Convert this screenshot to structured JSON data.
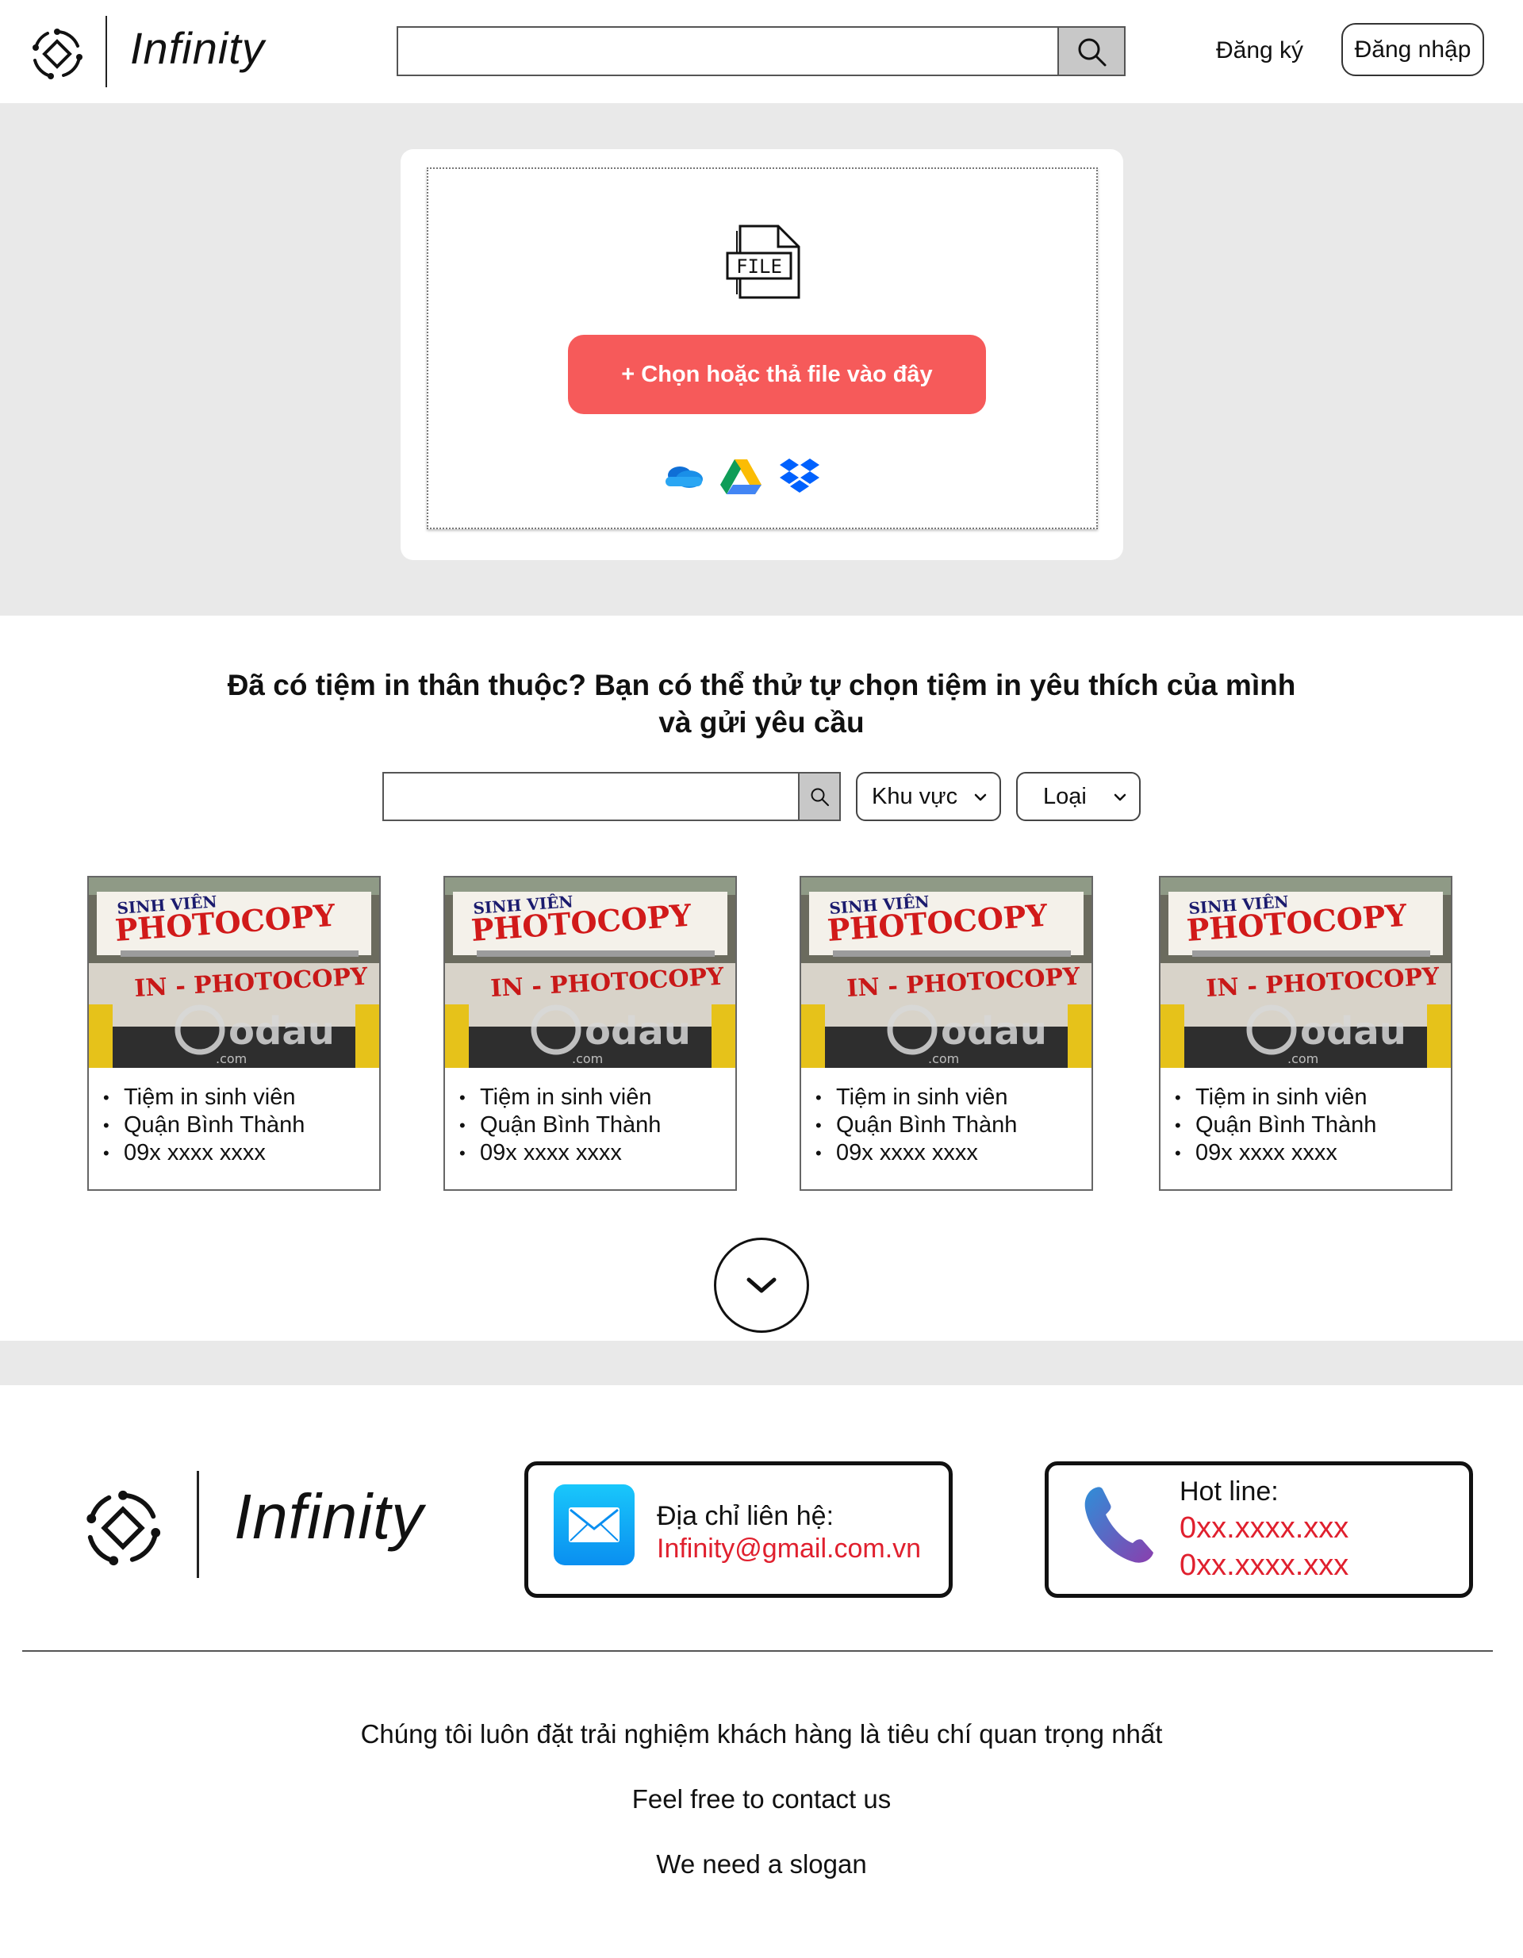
{
  "header": {
    "brand": "Infinity",
    "search_placeholder": "",
    "register_label": "Đăng ký",
    "login_label": "Đăng nhập"
  },
  "upload": {
    "file_icon_text": "FILE",
    "button_label": "+ Chọn hoặc thả file vào đây",
    "cloud_sources": [
      "onedrive-icon",
      "google-drive-icon",
      "dropbox-icon"
    ]
  },
  "shops": {
    "title_line1": "Đã có tiệm in thân thuộc? Bạn có thể thử tự chọn tiệm in yêu thích của mình",
    "title_line2": "và gửi yêu cầu",
    "search_placeholder": "",
    "filter_area": "Khu vực",
    "filter_type": "Loại",
    "photo_sign": {
      "line1": "SINH VIÊN",
      "line2": "PHOTOCOPY",
      "line3": "IN - PHOTOCOPY",
      "watermark": "odau",
      "watermark_sub": ".com"
    },
    "cards": [
      {
        "name": "Tiệm in sinh viên",
        "district": "Quận Bình Thành",
        "phone": "09x xxxx xxxx"
      },
      {
        "name": "Tiệm in sinh viên",
        "district": "Quận Bình Thành",
        "phone": "09x xxxx xxxx"
      },
      {
        "name": "Tiệm in sinh viên",
        "district": "Quận Bình Thành",
        "phone": "09x xxxx xxxx"
      },
      {
        "name": "Tiệm in sinh viên",
        "district": "Quận Bình Thành",
        "phone": "09x xxxx xxxx"
      }
    ]
  },
  "footer": {
    "brand": "Infinity",
    "email_label": "Địa chỉ liên hệ:",
    "email_value": "Infinity@gmail.com.vn",
    "hotline_label": "Hot line:",
    "hotline_1": "0xx.xxxx.xxx",
    "hotline_2": "0xx.xxxx.xxx",
    "line1": "Chúng tôi luôn đặt trải nghiệm khách hàng là tiêu chí quan trọng nhất",
    "line2": "Feel free to contact us",
    "line3": "We need a slogan"
  },
  "colors": {
    "accent": "#f65a5a",
    "band": "#e9e9e9",
    "contact_red": "#e0202e"
  }
}
